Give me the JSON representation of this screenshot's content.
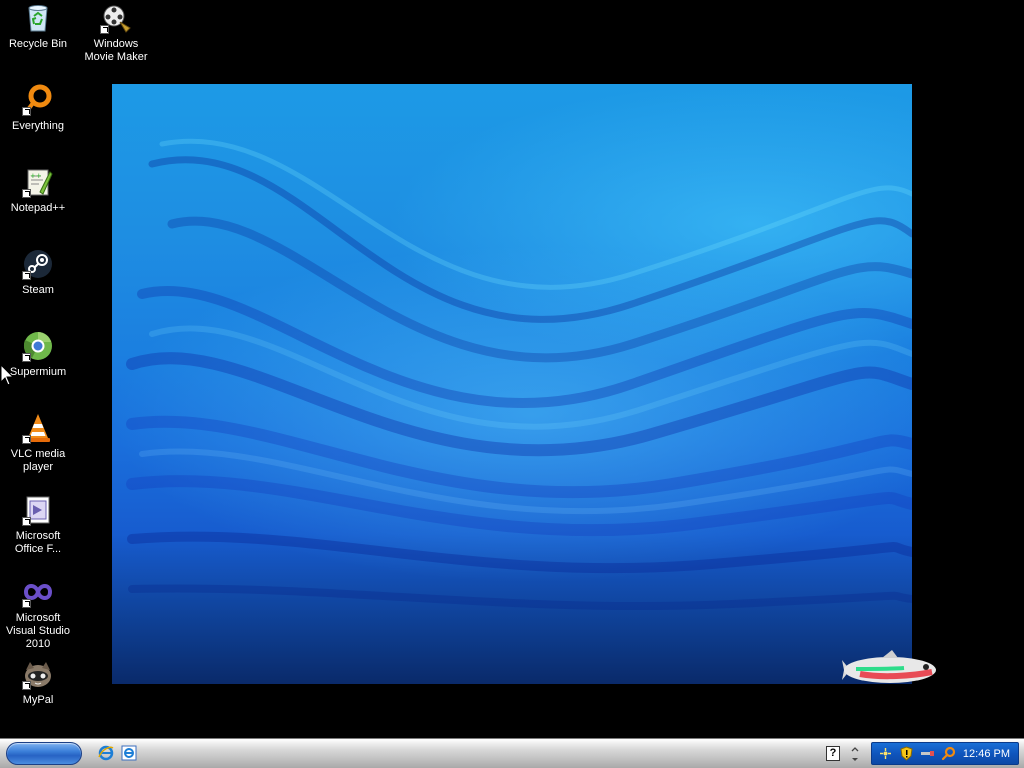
{
  "desktop": {
    "icons": [
      {
        "label": "Recycle Bin",
        "icon": "recycle-bin-icon"
      },
      {
        "label": "Windows Movie Maker",
        "icon": "movie-maker-icon"
      },
      {
        "label": "Everything",
        "icon": "everything-icon"
      },
      {
        "label": "Notepad++",
        "icon": "notepad-plus-plus-icon"
      },
      {
        "label": "Steam",
        "icon": "steam-icon"
      },
      {
        "label": "Supermium",
        "icon": "supermium-icon"
      },
      {
        "label": "VLC media player",
        "icon": "vlc-icon"
      },
      {
        "label": "Microsoft Office F...",
        "icon": "office-file-icon"
      },
      {
        "label": "Microsoft Visual Studio 2010",
        "icon": "visual-studio-icon"
      },
      {
        "label": "MyPal",
        "icon": "mypal-icon"
      }
    ],
    "wallpaper": "blue-waves-wallpaper"
  },
  "taskbar": {
    "start_button": "start-button",
    "quick_launch": [
      "internet-explorer-icon",
      "ie-page-icon"
    ],
    "help_label": "?",
    "tray_icons": [
      "network-icon",
      "security-shield-icon",
      "usb-icon",
      "search-icon"
    ],
    "clock": "12:46 PM"
  },
  "colors": {
    "taskbar": "#c8c8c8",
    "start_button": "#3b7fd9",
    "tray": "#0f55bd",
    "desktop_bg": "#000000"
  }
}
